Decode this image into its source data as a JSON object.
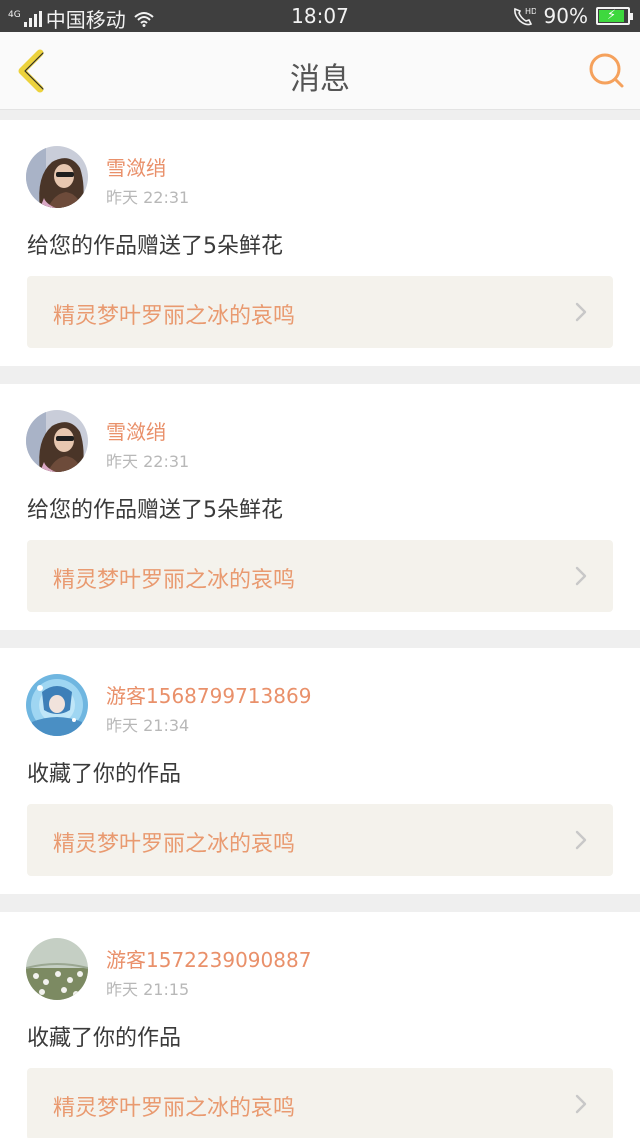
{
  "status_bar": {
    "network_type": "4G",
    "carrier": "中国移动",
    "time": "18:07",
    "call_badge": "HD",
    "battery": "90%",
    "battery_level": 0.9,
    "battery_color": "#3ed83e",
    "icons": [
      "signal-icon",
      "wifi-icon",
      "hd-call-icon",
      "battery-icon"
    ]
  },
  "nav": {
    "title": "消息",
    "back_icon": "chevron-left-icon",
    "search_icon": "search-icon",
    "accent_color": "#f5a15c",
    "back_color": "#ecd23c"
  },
  "colors": {
    "username": "#e9906a",
    "link_text": "#e99a70",
    "timestamp": "#b8b8b8",
    "link_background": "#f4f2ec"
  },
  "messages": [
    {
      "username": "雪潋绡",
      "time": "昨天 22:31",
      "action": "给您的作品赠送了5朵鲜花",
      "work_title": "精灵梦叶罗丽之冰的哀鸣",
      "avatar": "avatar-girl-sunglasses"
    },
    {
      "username": "雪潋绡",
      "time": "昨天 22:31",
      "action": "给您的作品赠送了5朵鲜花",
      "work_title": "精灵梦叶罗丽之冰的哀鸣",
      "avatar": "avatar-girl-sunglasses"
    },
    {
      "username": "游客1568799713869",
      "time": "昨天 21:34",
      "action": "收藏了你的作品",
      "work_title": "精灵梦叶罗丽之冰的哀鸣",
      "avatar": "avatar-anime-blue"
    },
    {
      "username": "游客1572239090887",
      "time": "昨天 21:15",
      "action": "收藏了你的作品",
      "work_title": "精灵梦叶罗丽之冰的哀鸣",
      "avatar": "avatar-flowers"
    }
  ]
}
